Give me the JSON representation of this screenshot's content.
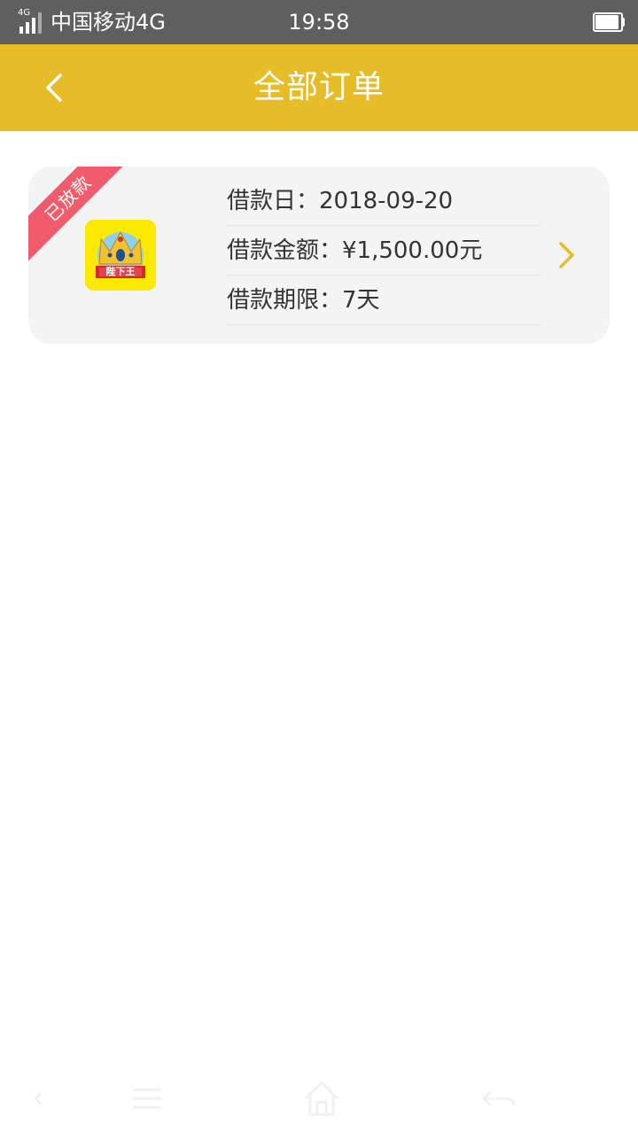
{
  "status_bar": {
    "network_badge": "4G",
    "carrier": "中国移动4G",
    "time": "19:58"
  },
  "header": {
    "title": "全部订单",
    "back_icon": "chevron-left-icon"
  },
  "order": {
    "status_ribbon": "已放款",
    "app_logo_text": "陛下王",
    "loan_date": "借款日：2018-09-20",
    "loan_amount": "借款金额：¥1,500.00元",
    "loan_term": "借款期限：7天",
    "detail_icon": "chevron-right-icon"
  },
  "system_nav": {
    "icons": [
      "back-icon",
      "menu-icon",
      "home-icon",
      "return-icon"
    ]
  },
  "colors": {
    "status_bar": "#5f5f5f",
    "header": "#e6bd28",
    "ribbon": "#f25b6b",
    "card": "#f4f4f4",
    "chevron": "#e6bd28",
    "logo_background": "#fbea00"
  }
}
